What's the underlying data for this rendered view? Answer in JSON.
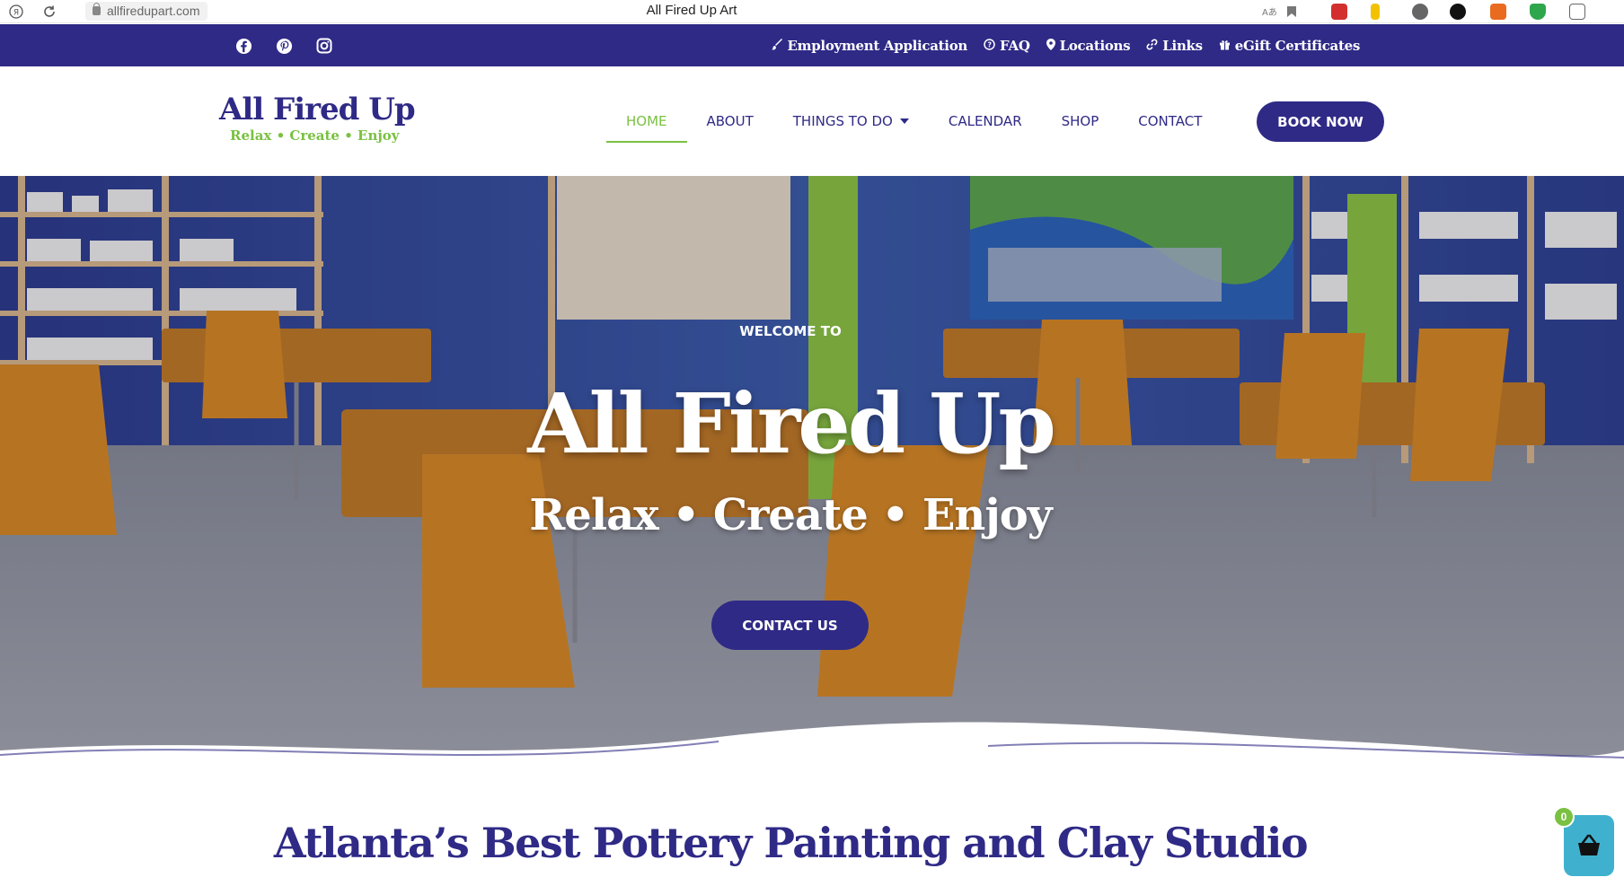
{
  "browser": {
    "url": "allfiredupart.com",
    "tab_title": "All Fired Up Art"
  },
  "topbar": {
    "social_icons": [
      "facebook-icon",
      "pinterest-icon",
      "instagram-icon"
    ],
    "links": [
      {
        "label": "Employment Application",
        "icon": "brush-icon"
      },
      {
        "label": "FAQ",
        "icon": "question-icon"
      },
      {
        "label": "Locations",
        "icon": "map-pin-icon"
      },
      {
        "label": "Links",
        "icon": "link-icon"
      },
      {
        "label": "eGift Certificates",
        "icon": "gift-icon"
      }
    ]
  },
  "logo": {
    "title": "All Fired Up",
    "tagline": "Relax • Create • Enjoy"
  },
  "nav": {
    "items": [
      {
        "label": "HOME"
      },
      {
        "label": "ABOUT"
      },
      {
        "label": "THINGS TO DO"
      },
      {
        "label": "CALENDAR"
      },
      {
        "label": "SHOP"
      },
      {
        "label": "CONTACT"
      }
    ],
    "active": "HOME",
    "book_label": "BOOK NOW"
  },
  "hero": {
    "welcome": "WELCOME TO",
    "title": "All Fired Up",
    "subtitle": "Relax • Create • Enjoy",
    "cta": "CONTACT US"
  },
  "section": {
    "title": "Atlanta’s Best Pottery Painting and Clay Studio"
  },
  "cart": {
    "count": "0"
  },
  "colors": {
    "brand_purple": "#2f2a86",
    "brand_green": "#7ac142",
    "cart_blue": "#3fb1cf"
  }
}
